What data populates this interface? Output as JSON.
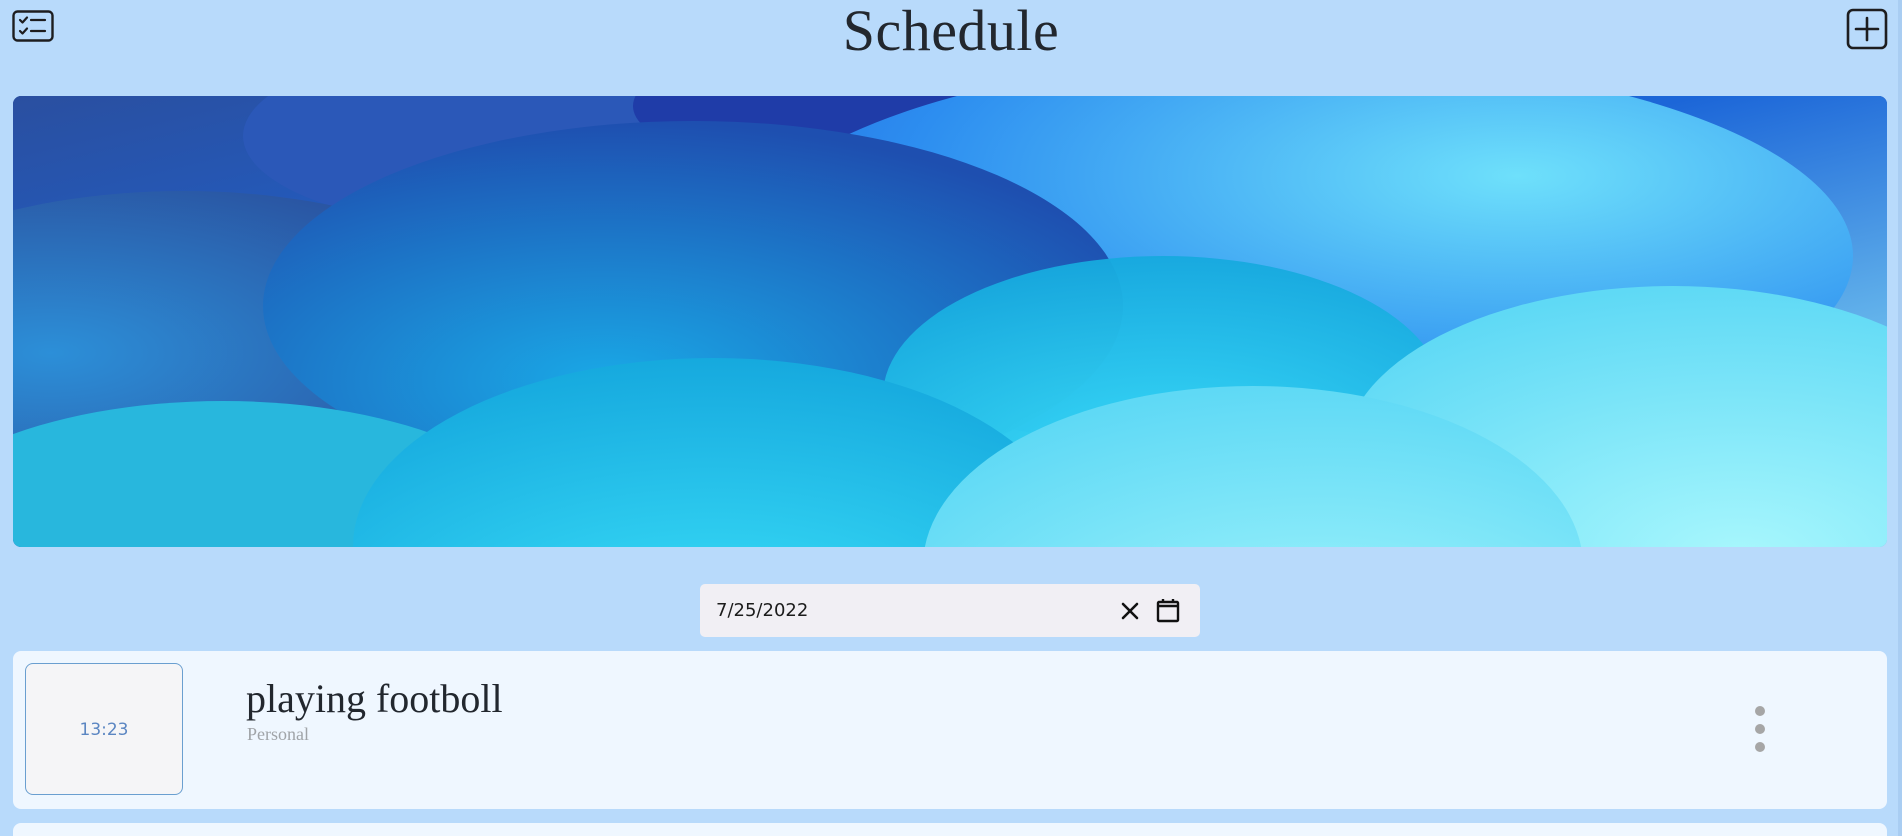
{
  "header": {
    "title": "Schedule",
    "menu_icon": "checklist-icon",
    "add_icon": "plus-square-icon"
  },
  "banner": {
    "image": "blue-bubbles-banner"
  },
  "date_filter": {
    "value": "7/25/2022",
    "clear_icon": "close-icon",
    "calendar_icon": "calendar-icon"
  },
  "events": [
    {
      "time": "13:23",
      "title": "playing footboll",
      "category": "Personal",
      "menu_icon": "kebab-menu-icon"
    }
  ],
  "colors": {
    "background": "#b8dafb",
    "card": "#eff7ff",
    "time_text": "#5b86c2",
    "title_text": "#22272e",
    "category_text": "#a0a4a8"
  }
}
